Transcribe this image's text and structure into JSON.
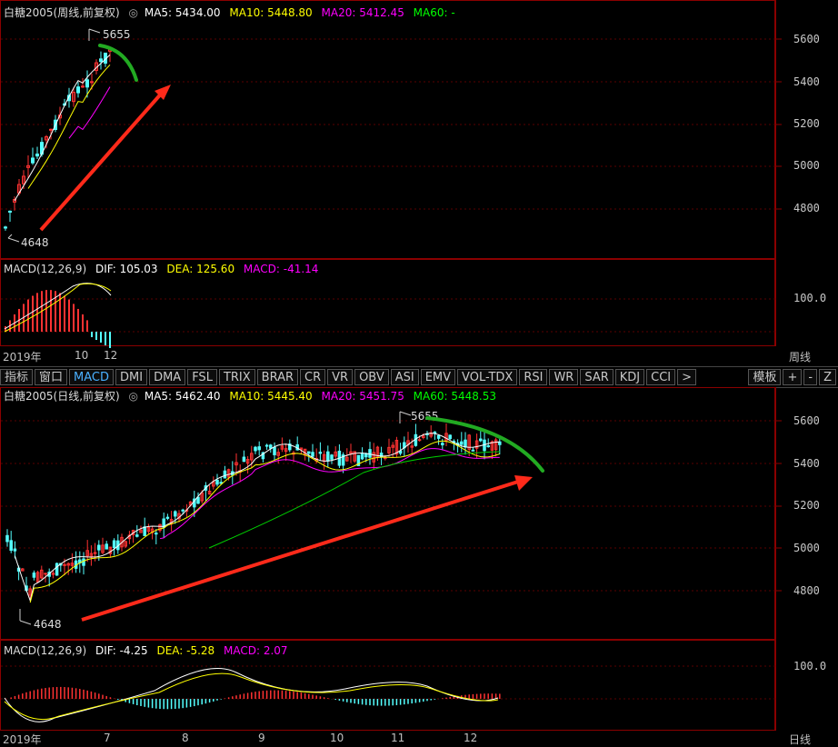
{
  "weekly": {
    "title": "白糖2005(周线,前复权)",
    "ma": [
      {
        "label": "MA5: 5434.00",
        "color": "#ffffff"
      },
      {
        "label": "MA10: 5448.80",
        "color": "#ffff00"
      },
      {
        "label": "MA20: 5412.45",
        "color": "#ff00ff"
      },
      {
        "label": "MA60: -",
        "color": "#00ff00"
      }
    ],
    "yticks": [
      "5600",
      "5400",
      "5200",
      "5000",
      "4800"
    ],
    "high_label": "5655",
    "low_label": "4648",
    "macd": {
      "title": "MACD(12,26,9)",
      "dif": "DIF: 105.03",
      "dea": "DEA: 125.60",
      "macd": "MACD: -41.14",
      "ytick": "100.0"
    },
    "x_labels": [
      "2019年",
      "10",
      "12"
    ],
    "period_label": "周线"
  },
  "tabs": {
    "left": [
      "指标",
      "窗口",
      "MACD",
      "DMI",
      "DMA",
      "FSL",
      "TRIX",
      "BRAR",
      "CR",
      "VR",
      "OBV",
      "ASI",
      "EMV",
      "VOL-TDX",
      "RSI",
      "WR",
      "SAR",
      "KDJ",
      "CCI",
      ">"
    ],
    "active": "MACD",
    "right": [
      "模板",
      "+",
      "-",
      "Z"
    ]
  },
  "daily": {
    "title": "白糖2005(日线,前复权)",
    "ma": [
      {
        "label": "MA5: 5462.40",
        "color": "#ffffff"
      },
      {
        "label": "MA10: 5445.40",
        "color": "#ffff00"
      },
      {
        "label": "MA20: 5451.75",
        "color": "#ff00ff"
      },
      {
        "label": "MA60: 5448.53",
        "color": "#00ff00"
      }
    ],
    "yticks": [
      "5600",
      "5400",
      "5200",
      "5000",
      "4800"
    ],
    "high_label": "5655",
    "low_label": "4648",
    "macd": {
      "title": "MACD(12,26,9)",
      "dif": "DIF: -4.25",
      "dea": "DEA: -5.28",
      "macd": "MACD: 2.07",
      "ytick": "100.0"
    },
    "x_labels": [
      "2019年",
      "7",
      "8",
      "9",
      "10",
      "11",
      "12"
    ],
    "period_label": "日线"
  },
  "colors": {
    "panel_border": "#8b0000",
    "up": "#ff3232",
    "down": "#54ffff",
    "arrow": "#ff2a1a",
    "trend": "#22aa22"
  }
}
